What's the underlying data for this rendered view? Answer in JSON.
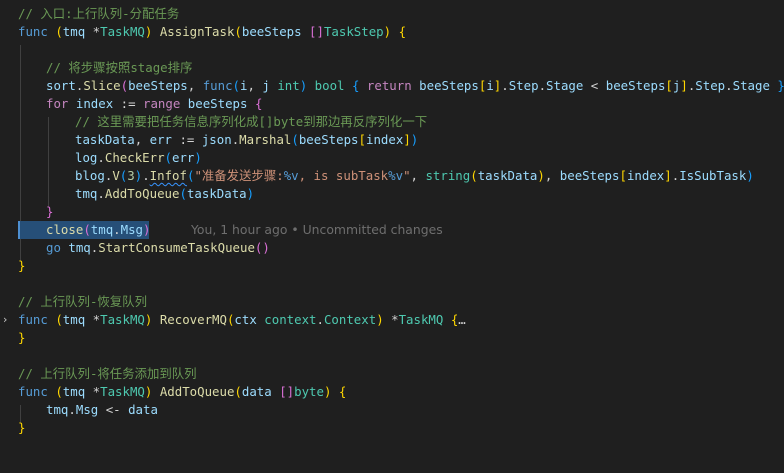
{
  "editor": {
    "language": "go",
    "blame_annotation": "You, 1 hour ago • Uncommitted changes"
  },
  "code": {
    "l1_comment": "// 入口:上行队列-分配任务",
    "l2": {
      "kw": "func",
      "recv": "(tmq *TaskMQ)",
      "name": "AssignTask",
      "open": "(",
      "param": "beeSteps []TaskStep",
      "close": ")",
      "brace": "{"
    },
    "l4_comment": "// 将步骤按照stage排序",
    "l5": "sort.Slice(beeSteps, func(i, j int) bool { return beeSteps[i].Step.Stage < beeSteps[j].Step.Stage })",
    "l6": {
      "for": "for",
      "var": "index",
      "op": " := ",
      "range": "range",
      "rest": " beeSteps ",
      "brace": "{"
    },
    "l7_comment": "// 这里需要把任务信息序列化成[]byte到那边再反序列化一下",
    "l8": "taskData, err := json.Marshal(beeSteps[index])",
    "l9": "log.CheckErr(err)",
    "l10": "blog.V(3).Infof(\"准备发送步骤:%v, is subTask%v\", string(taskData), beeSteps[index].IsSubTask)",
    "l11": "tmq.AddToQueue(taskData)",
    "l12": "}",
    "l13": "close(tmq.Msg)",
    "l14": "go tmq.StartConsumeTaskQueue()",
    "l15": "}",
    "l17_comment": "// 上行队列-恢复队列",
    "l18": "func (tmq *TaskMQ) RecoverMQ(ctx context.Context) *TaskMQ {",
    "l18_ellipsis": "…",
    "l19": "}",
    "l21_comment": "// 上行队列-将任务添加到队列",
    "l22": "func (tmq *TaskMQ) AddToQueue(data []byte) {",
    "l23": "tmq.Msg <- data",
    "l24": "}"
  },
  "icons": {
    "fold_collapsed": "chevron-right-icon",
    "fold_expanded": "chevron-down-icon"
  }
}
